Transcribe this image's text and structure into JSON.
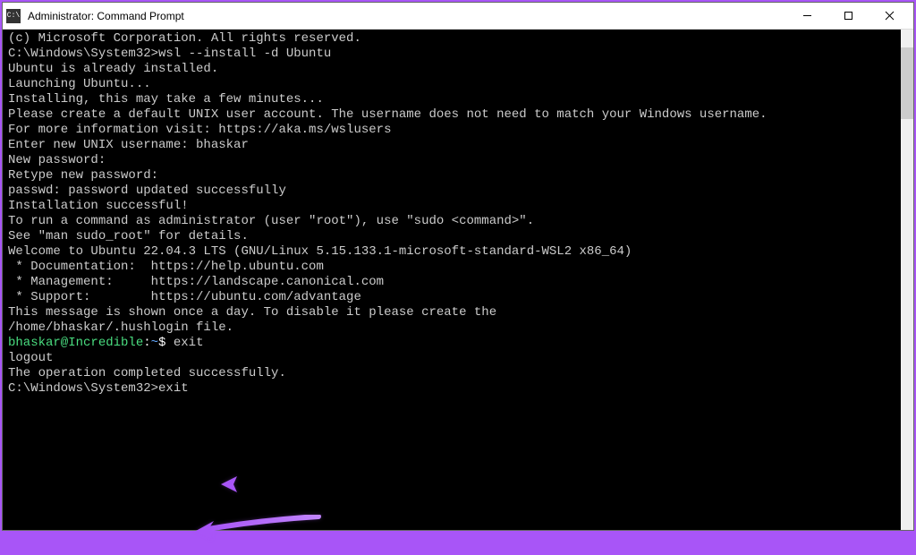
{
  "window": {
    "title": "Administrator: Command Prompt",
    "iconText": "C:\\"
  },
  "terminal": {
    "lines": [
      {
        "text": "(c) Microsoft Corporation. All rights reserved."
      },
      {
        "text": ""
      },
      {
        "text": "C:\\Windows\\System32>wsl --install -d Ubuntu"
      },
      {
        "text": "Ubuntu is already installed."
      },
      {
        "text": "Launching Ubuntu..."
      },
      {
        "text": "Installing, this may take a few minutes..."
      },
      {
        "text": "Please create a default UNIX user account. The username does not need to match your Windows username."
      },
      {
        "text": "For more information visit: https://aka.ms/wslusers"
      },
      {
        "text": "Enter new UNIX username: bhaskar"
      },
      {
        "text": "New password:"
      },
      {
        "text": "Retype new password:"
      },
      {
        "text": "passwd: password updated successfully"
      },
      {
        "text": "Installation successful!"
      },
      {
        "text": "To run a command as administrator (user \"root\"), use \"sudo <command>\"."
      },
      {
        "text": "See \"man sudo_root\" for details."
      },
      {
        "text": ""
      },
      {
        "text": "Welcome to Ubuntu 22.04.3 LTS (GNU/Linux 5.15.133.1-microsoft-standard-WSL2 x86_64)"
      },
      {
        "text": ""
      },
      {
        "text": " * Documentation:  https://help.ubuntu.com"
      },
      {
        "text": " * Management:     https://landscape.canonical.com"
      },
      {
        "text": " * Support:        https://ubuntu.com/advantage"
      },
      {
        "text": ""
      },
      {
        "text": ""
      },
      {
        "text": "This message is shown once a day. To disable it please create the"
      },
      {
        "text": "/home/bhaskar/.hushlogin file."
      }
    ],
    "bashPrompt": {
      "user": "bhaskar@Incredible",
      "sep": ":",
      "path": "~",
      "symbol": "$",
      "command": "exit"
    },
    "afterBash": [
      {
        "text": "logout"
      },
      {
        "text": "The operation completed successfully."
      },
      {
        "text": ""
      }
    ],
    "finalPrompt": {
      "path": "C:\\Windows\\System32>",
      "command": "exit"
    }
  },
  "annotations": {
    "arrowColor": "#a855f7"
  }
}
